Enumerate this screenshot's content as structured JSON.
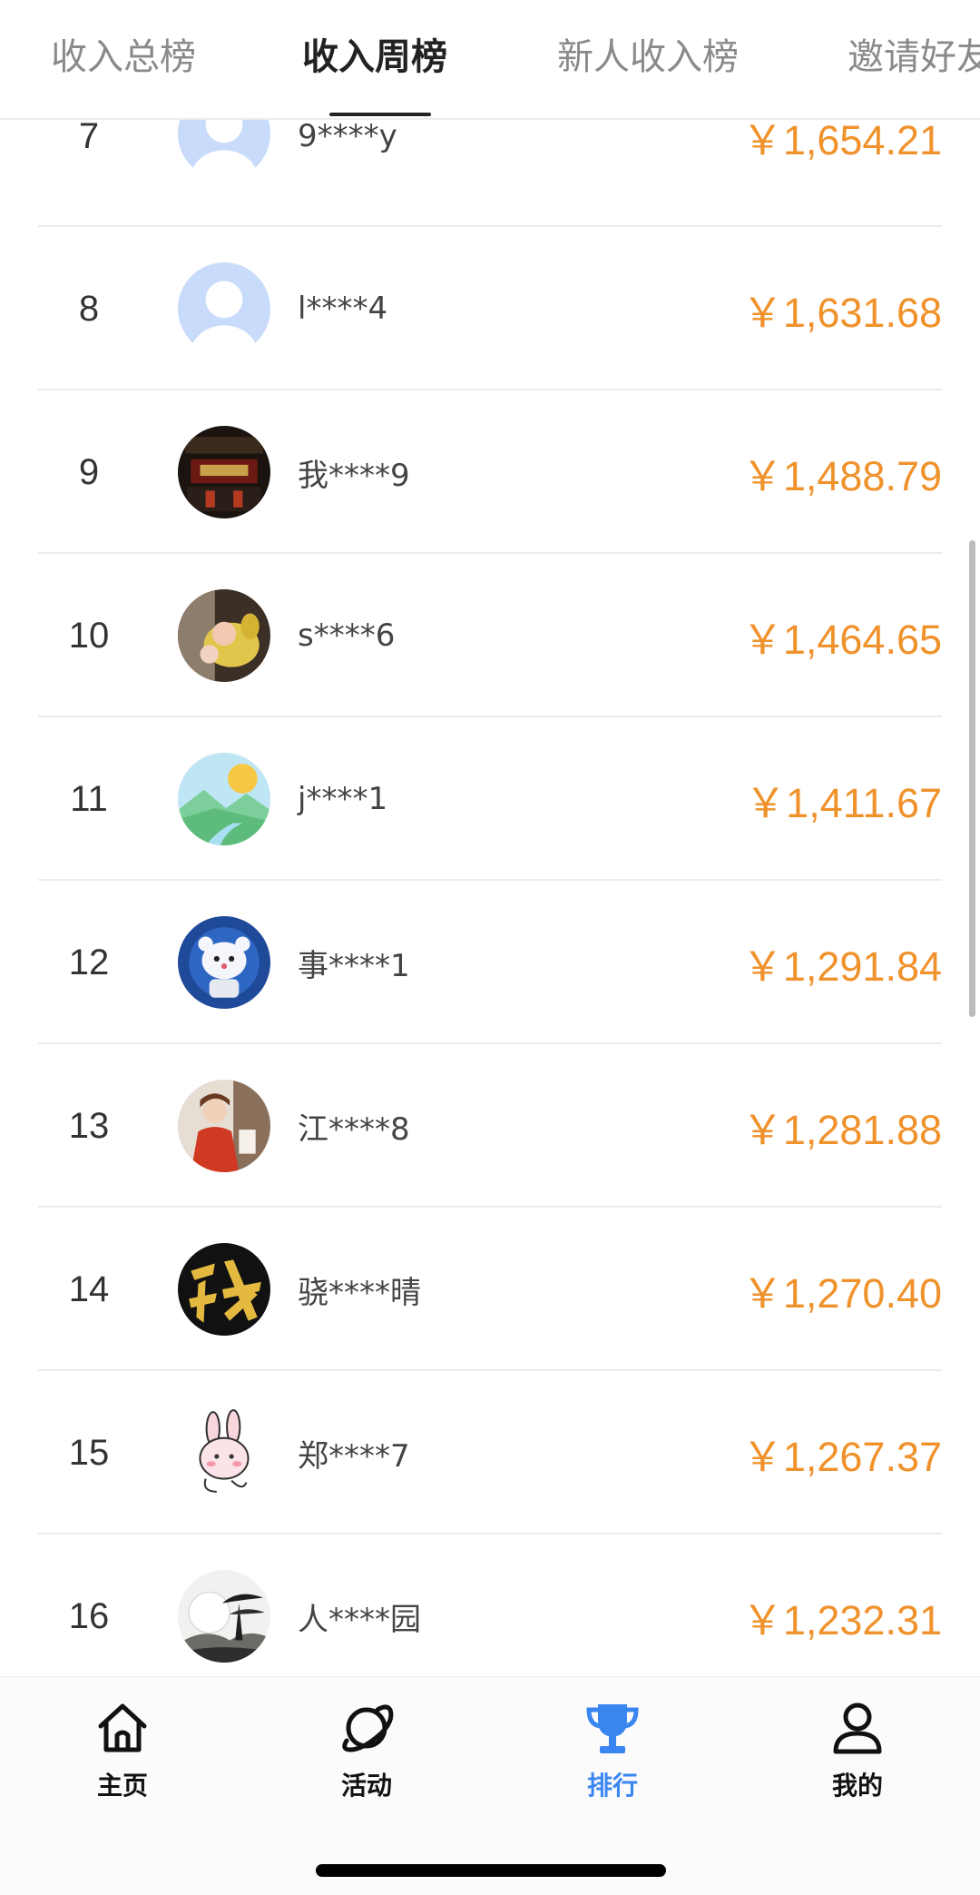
{
  "tabs": [
    {
      "label": "收入总榜"
    },
    {
      "label": "收入周榜"
    },
    {
      "label": "新人收入榜"
    },
    {
      "label": "邀请好友"
    }
  ],
  "active_tab": "收入周榜",
  "ranking": [
    {
      "rank": "7",
      "name": "9****y",
      "amount": "￥1,654.21",
      "avatar": "default-avatar"
    },
    {
      "rank": "8",
      "name": "l****4",
      "amount": "￥1,631.68",
      "avatar": "default-avatar"
    },
    {
      "rank": "9",
      "name": "我****9",
      "amount": "￥1,488.79",
      "avatar": "photo-avatar"
    },
    {
      "rank": "10",
      "name": "s****6",
      "amount": "￥1,464.65",
      "avatar": "photo-avatar"
    },
    {
      "rank": "11",
      "name": "j****1",
      "amount": "￥1,411.67",
      "avatar": "landscape-avatar"
    },
    {
      "rank": "12",
      "name": "事****1",
      "amount": "￥1,291.84",
      "avatar": "bear-avatar"
    },
    {
      "rank": "13",
      "name": "江****8",
      "amount": "￥1,281.88",
      "avatar": "photo-avatar"
    },
    {
      "rank": "14",
      "name": "骁****晴",
      "amount": "￥1,270.40",
      "avatar": "calligraphy-avatar"
    },
    {
      "rank": "15",
      "name": "郑****7",
      "amount": "￥1,267.37",
      "avatar": "rabbit-avatar"
    },
    {
      "rank": "16",
      "name": "人****园",
      "amount": "￥1,232.31",
      "avatar": "ink-painting-avatar"
    }
  ],
  "bottom_nav": [
    {
      "label": "主页",
      "icon": "home-icon"
    },
    {
      "label": "活动",
      "icon": "planet-icon"
    },
    {
      "label": "排行",
      "icon": "trophy-icon"
    },
    {
      "label": "我的",
      "icon": "user-icon"
    }
  ],
  "active_nav": "排行",
  "colors": {
    "amount": "#f0922b",
    "nav_active": "#3a86f0",
    "tab_active": "#222222",
    "tab_inactive": "#8a8a8a"
  }
}
